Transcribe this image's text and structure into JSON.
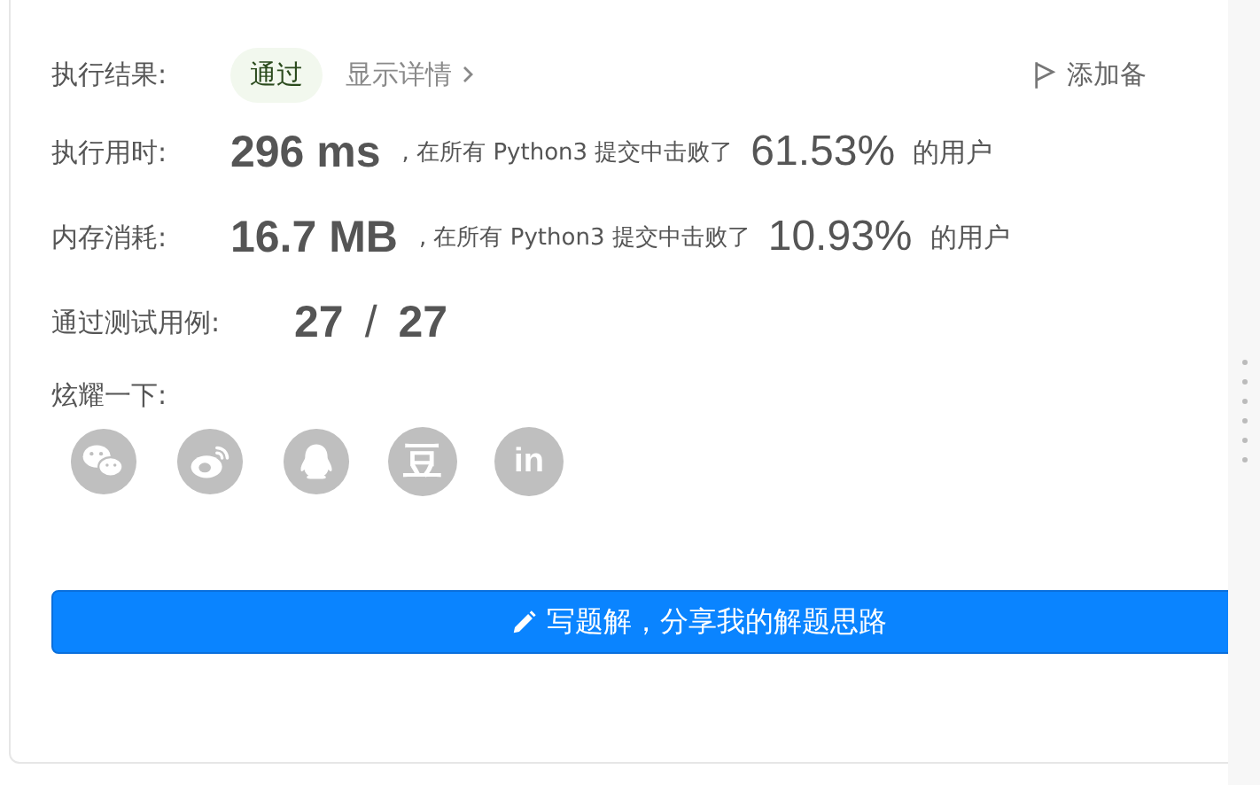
{
  "result": {
    "label": "执行结果:",
    "status": "通过",
    "details_link": "显示详情",
    "note_button": "添加备"
  },
  "stats": [
    {
      "label": "执行用时:",
      "value": "296 ms",
      "middle": ", 在所有 Python3 提交中击败了",
      "percent": "61.53%",
      "suffix": "的用户"
    },
    {
      "label": "内存消耗:",
      "value": "16.7 MB",
      "middle": ", 在所有 Python3 提交中击败了",
      "percent": "10.93%",
      "suffix": "的用户"
    }
  ],
  "testcases": {
    "label": "通过测试用例:",
    "passed": "27",
    "separator": "/",
    "total": "27"
  },
  "share": {
    "label": "炫耀一下:",
    "icons": [
      {
        "kind": "wechat"
      },
      {
        "kind": "weibo"
      },
      {
        "kind": "qq"
      },
      {
        "kind": "douban",
        "glyph": "豆"
      },
      {
        "kind": "linkedin",
        "glyph": "in"
      }
    ]
  },
  "write_button": "写题解，分享我的解题思路"
}
